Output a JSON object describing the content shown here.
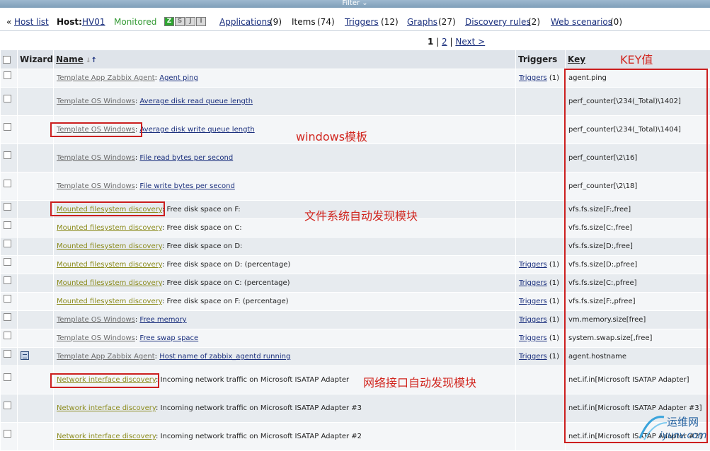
{
  "filter_bar": {
    "label": "Filter"
  },
  "host_nav": {
    "back_label": "Host list",
    "host_label": "Host:",
    "host_name": "HV01",
    "status": "Monitored",
    "availability": [
      "Z",
      "S",
      "J",
      "I"
    ],
    "links": [
      {
        "label": "Applications",
        "count": "(9)"
      },
      {
        "label": "Items",
        "count": "(74)"
      },
      {
        "label": "Triggers",
        "count": "(12)"
      },
      {
        "label": "Graphs",
        "count": "(27)"
      },
      {
        "label": "Discovery rules",
        "count": "(2)"
      },
      {
        "label": "Web scenarios",
        "count": "(0)"
      }
    ]
  },
  "pagination": {
    "current": "1",
    "page2": "2",
    "next": "Next >"
  },
  "table": {
    "headers": {
      "wizard": "Wizard",
      "name": "Name",
      "triggers": "Triggers",
      "key": "Key"
    },
    "rows": [
      {
        "prefix": "Template App Zabbix Agent",
        "prefix_type": "tpl",
        "name": "Agent ping",
        "name_link": true,
        "triggers": "Triggers",
        "trig_count": "(1)",
        "key": "agent.ping",
        "wizard": false
      },
      {
        "prefix": "Template OS Windows",
        "prefix_type": "tpl",
        "name": "Average disk read queue length",
        "name_link": true,
        "triggers": "",
        "trig_count": "",
        "key": "perf_counter[\\234(_Total)\\1402]",
        "wizard": false
      },
      {
        "prefix": "Template OS Windows",
        "prefix_type": "tpl",
        "name": "Average disk write queue length",
        "name_link": true,
        "triggers": "",
        "trig_count": "",
        "key": "perf_counter[\\234(_Total)\\1404]",
        "wizard": false
      },
      {
        "prefix": "Template OS Windows",
        "prefix_type": "tpl",
        "name": "File read bytes per second",
        "name_link": true,
        "triggers": "",
        "trig_count": "",
        "key": "perf_counter[\\2\\16]",
        "wizard": false
      },
      {
        "prefix": "Template OS Windows",
        "prefix_type": "tpl",
        "name": "File write bytes per second",
        "name_link": true,
        "triggers": "",
        "trig_count": "",
        "key": "perf_counter[\\2\\18]",
        "wizard": false
      },
      {
        "prefix": "Mounted filesystem discovery",
        "prefix_type": "disc",
        "name": "Free disk space on F:",
        "name_link": false,
        "triggers": "",
        "trig_count": "",
        "key": "vfs.fs.size[F:,free]",
        "wizard": false
      },
      {
        "prefix": "Mounted filesystem discovery",
        "prefix_type": "disc",
        "name": "Free disk space on C:",
        "name_link": false,
        "triggers": "",
        "trig_count": "",
        "key": "vfs.fs.size[C:,free]",
        "wizard": false
      },
      {
        "prefix": "Mounted filesystem discovery",
        "prefix_type": "disc",
        "name": "Free disk space on D:",
        "name_link": false,
        "triggers": "",
        "trig_count": "",
        "key": "vfs.fs.size[D:,free]",
        "wizard": false
      },
      {
        "prefix": "Mounted filesystem discovery",
        "prefix_type": "disc",
        "name": "Free disk space on D: (percentage)",
        "name_link": false,
        "triggers": "Triggers",
        "trig_count": "(1)",
        "key": "vfs.fs.size[D:,pfree]",
        "wizard": false
      },
      {
        "prefix": "Mounted filesystem discovery",
        "prefix_type": "disc",
        "name": "Free disk space on C: (percentage)",
        "name_link": false,
        "triggers": "Triggers",
        "trig_count": "(1)",
        "key": "vfs.fs.size[C:,pfree]",
        "wizard": false
      },
      {
        "prefix": "Mounted filesystem discovery",
        "prefix_type": "disc",
        "name": "Free disk space on F: (percentage)",
        "name_link": false,
        "triggers": "Triggers",
        "trig_count": "(1)",
        "key": "vfs.fs.size[F:,pfree]",
        "wizard": false
      },
      {
        "prefix": "Template OS Windows",
        "prefix_type": "tpl",
        "name": "Free memory",
        "name_link": true,
        "triggers": "Triggers",
        "trig_count": "(1)",
        "key": "vm.memory.size[free]",
        "wizard": false
      },
      {
        "prefix": "Template OS Windows",
        "prefix_type": "tpl",
        "name": "Free swap space",
        "name_link": true,
        "triggers": "Triggers",
        "trig_count": "(1)",
        "key": "system.swap.size[,free]",
        "wizard": false
      },
      {
        "prefix": "Template App Zabbix Agent",
        "prefix_type": "tpl",
        "name": "Host name of zabbix_agentd running",
        "name_link": true,
        "triggers": "Triggers",
        "trig_count": "(1)",
        "key": "agent.hostname",
        "wizard": true
      },
      {
        "prefix": "Network interface discovery",
        "prefix_type": "disc",
        "name": "Incoming network traffic on Microsoft ISATAP Adapter",
        "name_link": false,
        "triggers": "",
        "trig_count": "",
        "key": "net.if.in[Microsoft ISATAP Adapter]",
        "wizard": false
      },
      {
        "prefix": "Network interface discovery",
        "prefix_type": "disc",
        "name": "Incoming network traffic on Microsoft ISATAP Adapter #3",
        "name_link": false,
        "triggers": "",
        "trig_count": "",
        "key": "net.if.in[Microsoft ISATAP Adapter #3]",
        "wizard": false
      },
      {
        "prefix": "Network interface discovery",
        "prefix_type": "disc",
        "name": "Incoming network traffic on Microsoft ISATAP Adapter #2",
        "name_link": false,
        "triggers": "",
        "trig_count": "",
        "key": "net.if.in[Microsoft ISATAP Adapter #2]",
        "wizard": false
      }
    ]
  },
  "annotations": {
    "key_label": "KEY值",
    "windows_label": "windows模板",
    "fs_label": "文件系统自动发现模块",
    "net_label": "网络接口自动发现模块"
  },
  "watermark": {
    "top": "运维网",
    "bottom": "iyunv.com"
  },
  "colors": {
    "annotation_red": "#cc1f1f",
    "header_bg": "#dfe4ea",
    "link": "#1a2f7d",
    "discovery": "#8b8b1c",
    "monitored": "#339933"
  }
}
